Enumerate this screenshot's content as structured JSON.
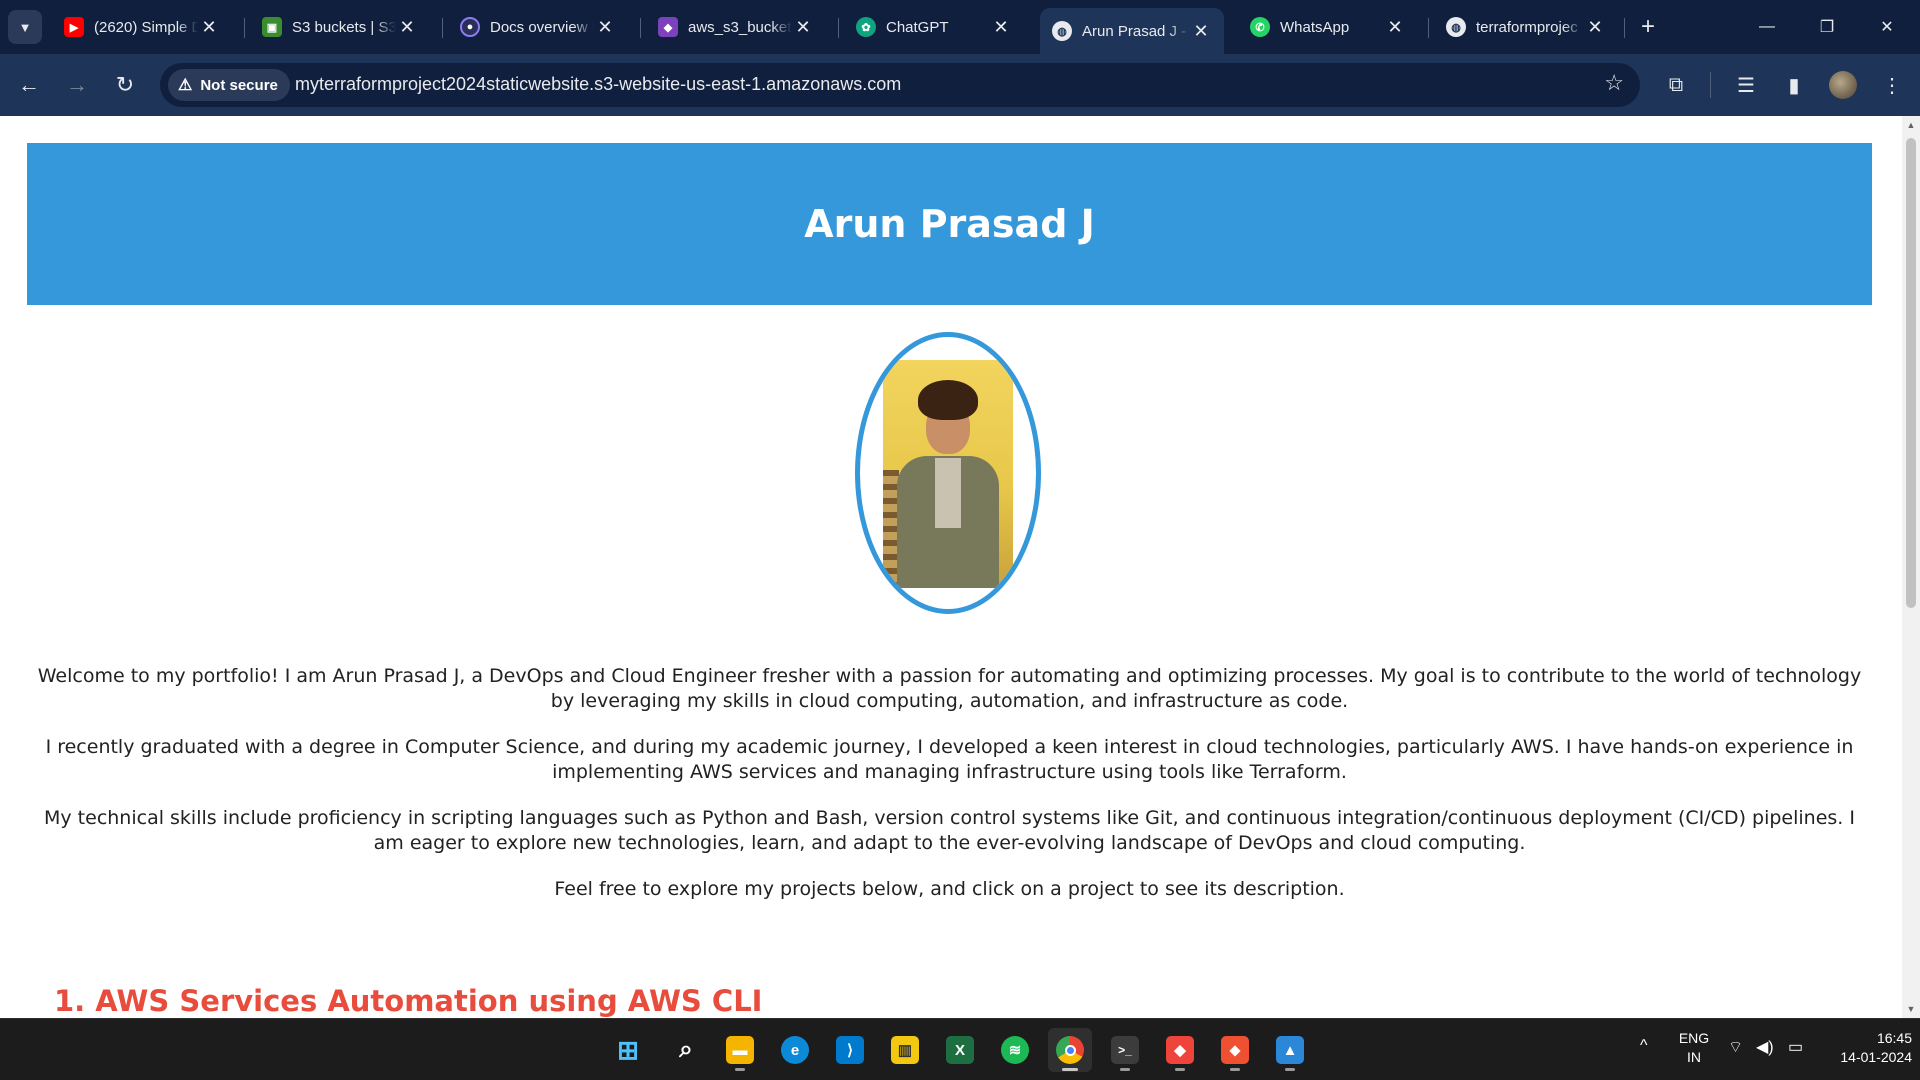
{
  "browser": {
    "tabs": [
      {
        "title": "(2620) Simple D",
        "icon": "youtube-icon",
        "color": "#ff0000"
      },
      {
        "title": "S3 buckets | S3",
        "icon": "aws-s3-icon",
        "color": "#3a8c2f"
      },
      {
        "title": "Docs overview |",
        "icon": "terraform-docs-icon",
        "color": "#5c4ee5"
      },
      {
        "title": "aws_s3_bucket",
        "icon": "terraform-icon",
        "color": "#7b42bc"
      },
      {
        "title": "ChatGPT",
        "icon": "chatgpt-icon",
        "color": "#10a37f"
      },
      {
        "title": "Arun Prasad J -",
        "icon": "globe-icon",
        "color": "#8ab4f8",
        "active": true
      },
      {
        "title": "WhatsApp",
        "icon": "whatsapp-icon",
        "color": "#25d366"
      },
      {
        "title": "terraformprojec",
        "icon": "globe-icon",
        "color": "#8ab4f8"
      }
    ],
    "security_label": "Not secure",
    "url": "myterraformproject2024staticwebsite.s3-website-us-east-1.amazonaws.com"
  },
  "page": {
    "header_title": "Arun Prasad J",
    "paragraphs": [
      "Welcome to my portfolio! I am Arun Prasad J, a DevOps and Cloud Engineer fresher with a passion for automating and optimizing processes. My goal is to contribute to the world of technology by leveraging my skills in cloud computing, automation, and infrastructure as code.",
      "I recently graduated with a degree in Computer Science, and during my academic journey, I developed a keen interest in cloud technologies, particularly AWS. I have hands-on experience in implementing AWS services and managing infrastructure using tools like Terraform.",
      "My technical skills include proficiency in scripting languages such as Python and Bash, version control systems like Git, and continuous integration/continuous deployment (CI/CD) pipelines. I am eager to explore new technologies, learn, and adapt to the ever-evolving landscape of DevOps and cloud computing.",
      "Feel free to explore my projects below, and click on a project to see its description."
    ],
    "project_heading": "1. AWS Services Automation using AWS CLI",
    "colors": {
      "header_bg": "#3498db",
      "heading_red": "#e74c3c"
    }
  },
  "taskbar": {
    "apps": [
      {
        "name": "start-button",
        "icon": "windows-icon",
        "color": "#0078d4"
      },
      {
        "name": "search-button",
        "icon": "search-icon",
        "color": "#1c1c1c"
      },
      {
        "name": "file-explorer-button",
        "icon": "folder-icon",
        "color": "#f4b400"
      },
      {
        "name": "edge-button",
        "icon": "edge-icon",
        "color": "#0c8ad8"
      },
      {
        "name": "vscode-button",
        "icon": "vscode-icon",
        "color": "#007acc"
      },
      {
        "name": "power-bi-button",
        "icon": "power-bi-icon",
        "color": "#f2c811"
      },
      {
        "name": "excel-button",
        "icon": "excel-icon",
        "color": "#1d6f42"
      },
      {
        "name": "spotify-button",
        "icon": "spotify-icon",
        "color": "#1db954"
      },
      {
        "name": "chrome-button",
        "icon": "chrome-icon",
        "color": "#4285f4"
      },
      {
        "name": "terminal-button",
        "icon": "terminal-icon",
        "color": "#3c3c3c"
      },
      {
        "name": "anydesk-button",
        "icon": "anydesk-icon",
        "color": "#ef443b"
      },
      {
        "name": "git-button",
        "icon": "git-icon",
        "color": "#f05032"
      },
      {
        "name": "photos-button",
        "icon": "photos-icon",
        "color": "#2b88d8"
      }
    ],
    "language_line1": "ENG",
    "language_line2": "IN",
    "time": "16:45",
    "date": "14-01-2024"
  }
}
